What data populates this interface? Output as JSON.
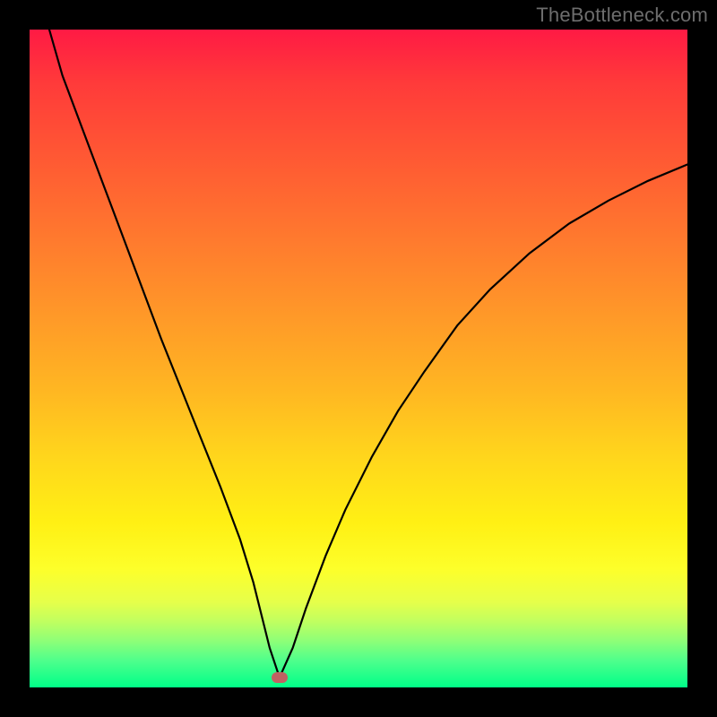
{
  "watermark": "TheBottleneck.com",
  "colors": {
    "frame": "#000000",
    "watermark": "#6d6d6d",
    "curve": "#000000",
    "marker": "#c06262",
    "gradient_stops": [
      "#ff1a44",
      "#ff3a3a",
      "#ff5a33",
      "#ff7a2e",
      "#ff9a28",
      "#ffb722",
      "#ffd61c",
      "#fff014",
      "#fdff2a",
      "#e6ff4a",
      "#c0ff60",
      "#8cff78",
      "#4dff8c",
      "#00ff88"
    ]
  },
  "chart_data": {
    "type": "line",
    "title": "",
    "xlabel": "",
    "ylabel": "",
    "xlim": [
      0,
      100
    ],
    "ylim": [
      0,
      100
    ],
    "grid": false,
    "legend": false,
    "annotations": [
      {
        "kind": "marker",
        "shape": "rounded-rect",
        "x": 38,
        "y": 1.5,
        "color": "#c06262"
      }
    ],
    "series": [
      {
        "name": "bottleneck-curve",
        "color": "#000000",
        "x": [
          3,
          5,
          8,
          11,
          14,
          17,
          20,
          23,
          26,
          29,
          32,
          34,
          35.5,
          36.5,
          38,
          40,
          42,
          45,
          48,
          52,
          56,
          60,
          65,
          70,
          76,
          82,
          88,
          94,
          100
        ],
        "y": [
          100,
          93,
          85,
          77,
          69,
          61,
          53,
          45.5,
          38,
          30.5,
          22.5,
          16,
          10,
          6,
          1.5,
          6,
          12,
          20,
          27,
          35,
          42,
          48,
          55,
          60.5,
          66,
          70.5,
          74,
          77,
          79.5
        ]
      }
    ]
  }
}
